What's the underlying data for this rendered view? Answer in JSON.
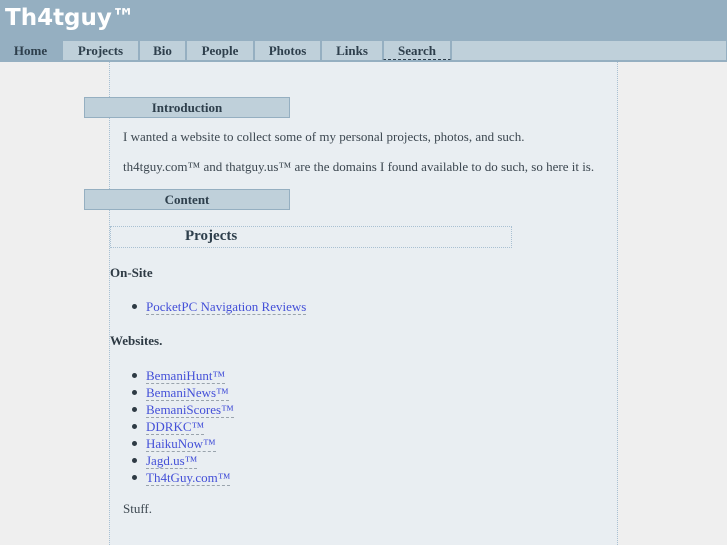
{
  "site": {
    "title": "Th4tguy™"
  },
  "nav": {
    "items": [
      {
        "label": "Home",
        "active": true
      },
      {
        "label": "Projects"
      },
      {
        "label": "Bio"
      },
      {
        "label": "People"
      },
      {
        "label": "Photos"
      },
      {
        "label": "Links"
      },
      {
        "label": "Search"
      }
    ]
  },
  "introduction": {
    "heading": "Introduction",
    "paragraphs": [
      "I wanted a website to collect some of my personal projects, photos, and such.",
      "th4tguy.com™ and thatguy.us™ are the domains I found available to do such, so here it is."
    ]
  },
  "content": {
    "heading": "Content",
    "projects_title": "Projects",
    "on_site": {
      "heading": "On-Site",
      "links": [
        "PocketPC Navigation Reviews"
      ]
    },
    "websites": {
      "heading": "Websites.",
      "links": [
        "BemaniHunt™",
        "BemaniNews™",
        "BemaniScores™",
        "DDRKC™",
        "HaikuNow™",
        "Jagd.us™",
        "Th4tGuy.com™"
      ]
    },
    "footer_text": "Stuff."
  },
  "colors": {
    "header_bg": "#95afc1",
    "tab_bg": "#bfd0da",
    "content_bg": "#e9eef2",
    "link": "#4450d8"
  }
}
